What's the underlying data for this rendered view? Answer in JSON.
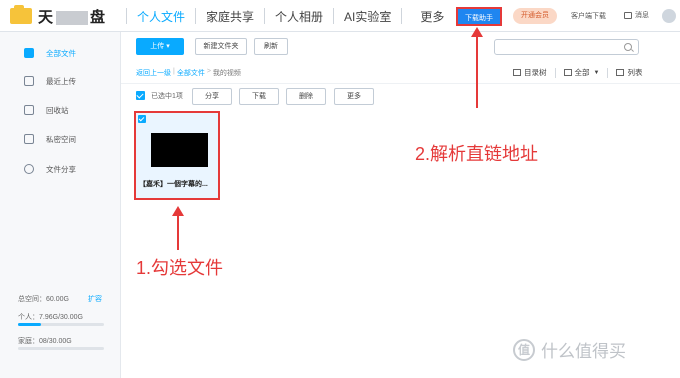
{
  "logo": {
    "text_left": "天",
    "text_right": "盘"
  },
  "nav": {
    "items": [
      "个人文件",
      "家庭共享",
      "个人相册",
      "AI实验室",
      "更多"
    ]
  },
  "header": {
    "download_helper": "下载助手",
    "vip": "开通会员",
    "client_download": "客户端下载",
    "messages": "消息"
  },
  "sidebar": {
    "items": [
      "全部文件",
      "最近上传",
      "回收站",
      "私密空间",
      "文件分享"
    ],
    "total_space": "总空间：60.00G",
    "expand": "扩容",
    "personal": "个人：7.96G/30.00G",
    "personal_fill": 0.27,
    "family": "家庭：08/30.00G",
    "family_fill": 0.0
  },
  "toolbar": {
    "upload": "上传",
    "new_folder": "新建文件夹",
    "refresh": "刷新"
  },
  "breadcrumb": {
    "back": "返回上一级",
    "all_files": "全部文件",
    "current": "我的视频"
  },
  "view_tools": {
    "tree": "目录树",
    "filter": "全部",
    "list": "列表"
  },
  "selection": {
    "text": "已选中1项",
    "share": "分享",
    "download": "下载",
    "delete": "删除",
    "more": "更多"
  },
  "file": {
    "name": "【嘉禾】一個字幕的..."
  },
  "annotations": {
    "step1": "1.勾选文件",
    "step2": "2.解析直链地址",
    "color": "#e53939"
  },
  "watermark": {
    "icon": "值",
    "text": "什么值得买"
  }
}
